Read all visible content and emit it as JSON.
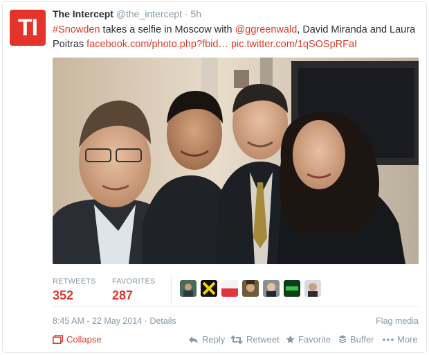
{
  "tweet": {
    "avatar_text": "TI",
    "author_name": "The Intercept",
    "handle": "@the_intercept",
    "time_sep": "·",
    "time": "5h",
    "text_parts": {
      "hashtag": "#Snowden",
      "t1": " takes a selfie in Moscow with ",
      "mention": "@ggreenwald",
      "t2": ", David Miranda and Laura Poitras ",
      "fb_link": "facebook.com/photo.php?fbid…",
      "t3": " ",
      "pic_link": "pic.twitter.com/1qSOSpRFaI"
    }
  },
  "stats": {
    "retweets_label": "RETWEETS",
    "retweets_value": "352",
    "favorites_label": "FAVORITES",
    "favorites_value": "287"
  },
  "meta": {
    "timestamp": "8:45 AM - 22 May 2014",
    "sep": "·",
    "details": "Details",
    "flag": "Flag media"
  },
  "actions": {
    "collapse": "Collapse",
    "reply": "Reply",
    "retweet": "Retweet",
    "favorite": "Favorite",
    "buffer": "Buffer",
    "more": "More"
  },
  "colors": {
    "brand_red": "#e3332a",
    "link_red": "#d93c2f",
    "muted_gray": "#8899a6"
  },
  "icons": [
    "reply-icon",
    "retweet-icon",
    "star-icon",
    "buffer-icon",
    "more-dots-icon",
    "collapse-icon"
  ]
}
